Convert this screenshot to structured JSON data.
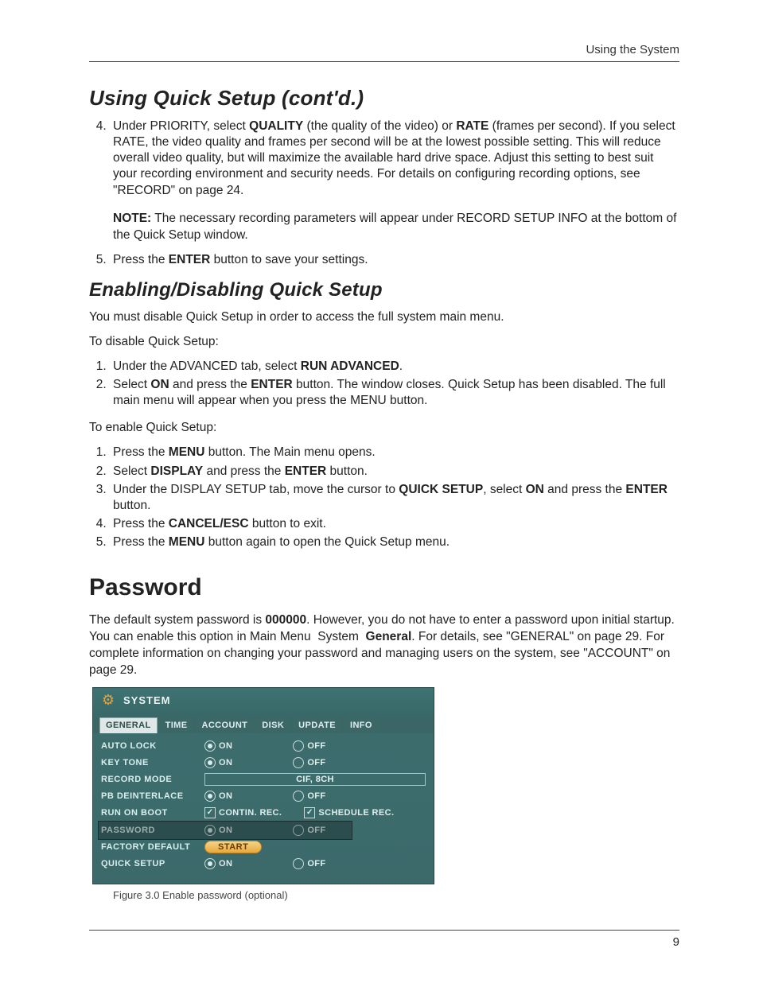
{
  "header": {
    "section": "Using the System"
  },
  "h_contd": "Using Quick Setup (cont'd.)",
  "step4": "Under PRIORITY, select QUALITY (the quality of the video) or RATE (frames per second). If you select RATE, the video quality and frames per second will be at the lowest possible setting. This will reduce overall video quality, but will maximize the available hard drive space. Adjust this setting to best suit your recording environment and security needs. For details on configuring recording options, see \"RECORD\" on page 24.",
  "note": "NOTE: The necessary recording parameters will appear under RECORD SETUP INFO at the bottom of the Quick Setup window.",
  "step5": "Press the ENTER button to save your settings.",
  "h_enable": "Enabling/Disabling Quick Setup",
  "enable_intro": "You must disable Quick Setup in order to access the full system main menu.",
  "disable_lead": "To disable Quick Setup:",
  "dis1": "Under the ADVANCED tab, select RUN ADVANCED.",
  "dis2": "Select ON and press the ENTER button. The window closes. Quick Setup has been disabled. The full main menu will appear when you press the MENU button.",
  "enable_lead": "To enable Quick Setup:",
  "en1": "Press the MENU button. The Main menu opens.",
  "en2": "Select DISPLAY and press the ENTER button.",
  "en3": "Under the DISPLAY SETUP tab, move the cursor to QUICK SETUP, select ON and press the ENTER button.",
  "en4": "Press the CANCEL/ESC button to exit.",
  "en5": "Press the MENU button again to open the Quick Setup menu.",
  "h_password": "Password",
  "password_para": "The default system password is 000000. However, you do not have to enter a password upon initial startup. You can enable this option in Main Menu  System  General. For details, see \"GENERAL\" on page 29. For complete information on changing your password and managing users on the system, see \"ACCOUNT\" on page 29.",
  "panel": {
    "title": "SYSTEM",
    "tabs": [
      "GENERAL",
      "TIME",
      "ACCOUNT",
      "DISK",
      "UPDATE",
      "INFO"
    ],
    "rows": {
      "auto_lock": "AUTO LOCK",
      "key_tone": "KEY TONE",
      "record_mode": "RECORD MODE",
      "record_mode_val": "CIF, 8CH",
      "pb": "PB DEINTERLACE",
      "run": "RUN ON BOOT",
      "run_a": "CONTIN. REC.",
      "run_b": "SCHEDULE REC.",
      "password": "PASSWORD",
      "factory": "FACTORY DEFAULT",
      "start": "START",
      "quick": "QUICK SETUP",
      "on": "ON",
      "off": "OFF"
    }
  },
  "caption": "Figure 3.0 Enable password (optional)",
  "page_number": "9"
}
